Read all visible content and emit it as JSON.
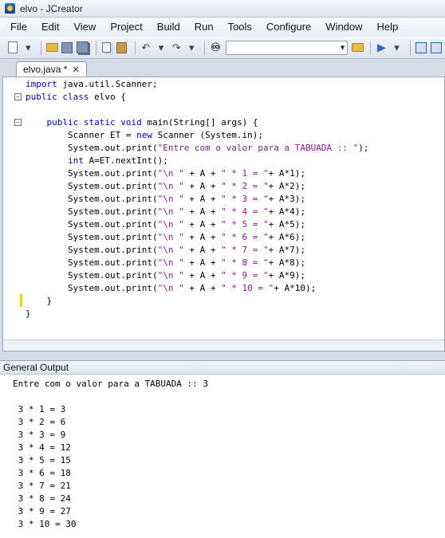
{
  "window": {
    "title": "elvo - JCreator"
  },
  "menu": [
    "File",
    "Edit",
    "View",
    "Project",
    "Build",
    "Run",
    "Tools",
    "Configure",
    "Window",
    "Help"
  ],
  "editor": {
    "tab": {
      "label": "elvo.java *",
      "close": "✕"
    },
    "lines": [
      [
        [
          "kw",
          "import"
        ],
        [
          "p",
          " java.util.Scanner;"
        ]
      ],
      [
        [
          "kw",
          "public"
        ],
        [
          "p",
          " "
        ],
        [
          "kw",
          "class"
        ],
        [
          "p",
          " elvo {"
        ]
      ],
      [
        [
          "p",
          ""
        ]
      ],
      [
        [
          "p",
          "    "
        ],
        [
          "kw",
          "public"
        ],
        [
          "p",
          " "
        ],
        [
          "kw",
          "static"
        ],
        [
          "p",
          " "
        ],
        [
          "kw",
          "void"
        ],
        [
          "p",
          " main(String[] args) {"
        ]
      ],
      [
        [
          "p",
          "        Scanner ET = "
        ],
        [
          "kw",
          "new"
        ],
        [
          "p",
          " Scanner (System.in);"
        ]
      ],
      [
        [
          "p",
          "        System.out.print("
        ],
        [
          "str",
          "\"Entre com o valor para a TABUADA :: \""
        ],
        [
          "p",
          ");"
        ]
      ],
      [
        [
          "p",
          "        "
        ],
        [
          "kw",
          "int"
        ],
        [
          "p",
          " A=ET.nextInt();"
        ]
      ],
      [
        [
          "p",
          "        System.out.print("
        ],
        [
          "str",
          "\"\\n \""
        ],
        [
          "p",
          " + A + "
        ],
        [
          "str",
          "\" * 1 = \""
        ],
        [
          "p",
          "+ A*1);"
        ]
      ],
      [
        [
          "p",
          "        System.out.print("
        ],
        [
          "str",
          "\"\\n \""
        ],
        [
          "p",
          " + A + "
        ],
        [
          "str",
          "\" * 2 = \""
        ],
        [
          "p",
          "+ A*2);"
        ]
      ],
      [
        [
          "p",
          "        System.out.print("
        ],
        [
          "str",
          "\"\\n \""
        ],
        [
          "p",
          " + A + "
        ],
        [
          "str",
          "\" * 3 = \""
        ],
        [
          "p",
          "+ A*3);"
        ]
      ],
      [
        [
          "p",
          "        System.out.print("
        ],
        [
          "str",
          "\"\\n \""
        ],
        [
          "p",
          " + A + "
        ],
        [
          "str",
          "\" * 4 = \""
        ],
        [
          "p",
          "+ A*4);"
        ]
      ],
      [
        [
          "p",
          "        System.out.print("
        ],
        [
          "str",
          "\"\\n \""
        ],
        [
          "p",
          " + A + "
        ],
        [
          "str",
          "\" * 5 = \""
        ],
        [
          "p",
          "+ A*5);"
        ]
      ],
      [
        [
          "p",
          "        System.out.print("
        ],
        [
          "str",
          "\"\\n \""
        ],
        [
          "p",
          " + A + "
        ],
        [
          "str",
          "\" * 6 = \""
        ],
        [
          "p",
          "+ A*6);"
        ]
      ],
      [
        [
          "p",
          "        System.out.print("
        ],
        [
          "str",
          "\"\\n \""
        ],
        [
          "p",
          " + A + "
        ],
        [
          "str",
          "\" * 7 = \""
        ],
        [
          "p",
          "+ A*7);"
        ]
      ],
      [
        [
          "p",
          "        System.out.print("
        ],
        [
          "str",
          "\"\\n \""
        ],
        [
          "p",
          " + A + "
        ],
        [
          "str",
          "\" * 8 = \""
        ],
        [
          "p",
          "+ A*8);"
        ]
      ],
      [
        [
          "p",
          "        System.out.print("
        ],
        [
          "str",
          "\"\\n \""
        ],
        [
          "p",
          " + A + "
        ],
        [
          "str",
          "\" * 9 = \""
        ],
        [
          "p",
          "+ A*9);"
        ]
      ],
      [
        [
          "p",
          "        System.out.print("
        ],
        [
          "str",
          "\"\\n \""
        ],
        [
          "p",
          " + A + "
        ],
        [
          "str",
          "\" * 10 = \""
        ],
        [
          "p",
          "+ A*10);"
        ]
      ],
      [
        [
          "p",
          "    }"
        ]
      ],
      [
        [
          "p",
          "}"
        ]
      ]
    ]
  },
  "output": {
    "title": "General Output",
    "lines": [
      "Entre com o valor para a TABUADA :: 3",
      "",
      " 3 * 1 = 3",
      " 3 * 2 = 6",
      " 3 * 3 = 9",
      " 3 * 4 = 12",
      " 3 * 5 = 15",
      " 3 * 6 = 18",
      " 3 * 7 = 21",
      " 3 * 8 = 24",
      " 3 * 9 = 27",
      " 3 * 10 = 30"
    ]
  },
  "colors": {
    "keyword": "#0000c0",
    "string": "#8a1a9a",
    "chrome": "#d4dce8"
  }
}
